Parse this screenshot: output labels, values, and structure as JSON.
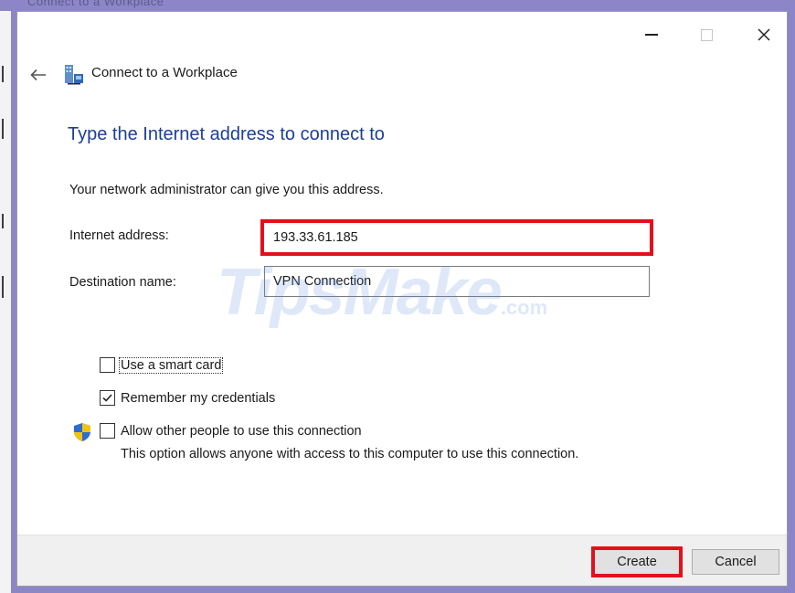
{
  "background_title": "Connect to a Workplace",
  "window": {
    "title": "Connect to a Workplace",
    "controls": {
      "minimize": "minimize",
      "maximize": "maximize",
      "close": "close"
    }
  },
  "page": {
    "heading": "Type the Internet address to connect to",
    "subtext": "Your network administrator can give you this address."
  },
  "form": {
    "internet_address_label": "Internet address:",
    "internet_address_value": "193.33.61.185",
    "destination_name_label": "Destination name:",
    "destination_name_value": "VPN Connection"
  },
  "options": {
    "smart_card": {
      "label": "Use a smart card",
      "checked": false
    },
    "remember": {
      "label": "Remember my credentials",
      "checked": true
    },
    "allow_others": {
      "label": "Allow other people to use this connection",
      "checked": false,
      "description": "This option allows anyone with access to this computer to use this connection."
    }
  },
  "buttons": {
    "create": "Create",
    "cancel": "Cancel"
  },
  "watermark": {
    "brand": "TipsMake",
    "suffix": ".com"
  },
  "colors": {
    "heading": "#1c3f96",
    "highlight": "#e3101c",
    "footer_bg": "#f0f0f0"
  },
  "icons": [
    "back-arrow-icon",
    "network-icon",
    "shield-icon",
    "checkmark-icon",
    "close-icon"
  ]
}
